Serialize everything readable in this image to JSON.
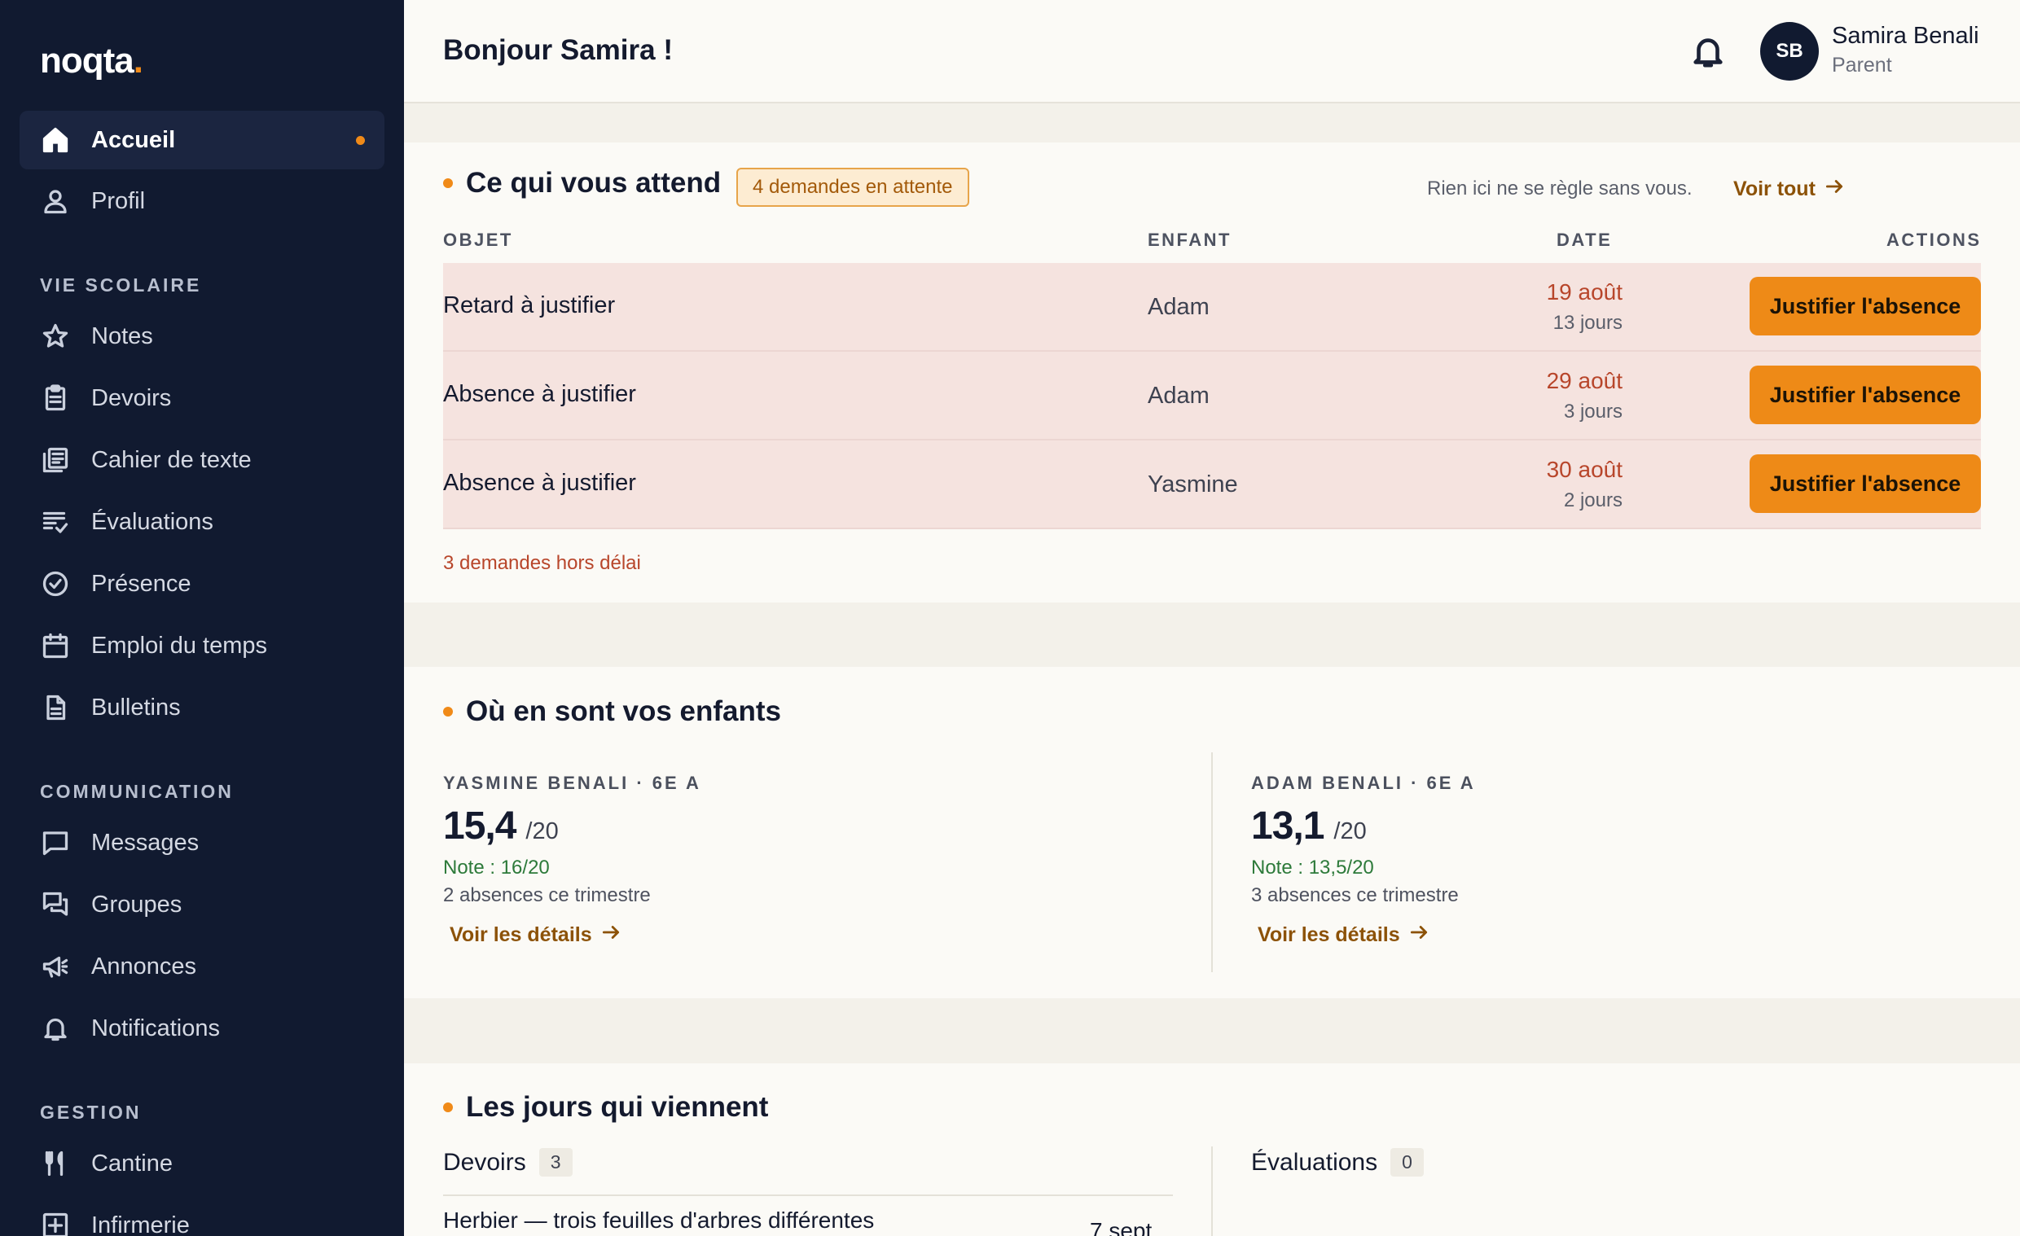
{
  "app": {
    "logo_text": "noqta",
    "logo_dot": ".",
    "accent_color": "#f08a18",
    "sidebar_bg": "#111a30"
  },
  "sidebar": {
    "top_items": [
      {
        "label": "Accueil",
        "icon": "home-icon",
        "active": true
      },
      {
        "label": "Profil",
        "icon": "user-icon",
        "active": false
      }
    ],
    "sections": [
      {
        "title": "VIE SCOLAIRE",
        "items": [
          {
            "label": "Notes",
            "icon": "star-icon"
          },
          {
            "label": "Devoirs",
            "icon": "clipboard-icon"
          },
          {
            "label": "Cahier de texte",
            "icon": "notebook-icon"
          },
          {
            "label": "Évaluations",
            "icon": "checklist-icon"
          },
          {
            "label": "Présence",
            "icon": "check-circle-icon"
          },
          {
            "label": "Emploi du temps",
            "icon": "calendar-icon"
          },
          {
            "label": "Bulletins",
            "icon": "document-icon"
          }
        ]
      },
      {
        "title": "COMMUNICATION",
        "items": [
          {
            "label": "Messages",
            "icon": "message-icon"
          },
          {
            "label": "Groupes",
            "icon": "chat-group-icon"
          },
          {
            "label": "Annonces",
            "icon": "megaphone-icon"
          },
          {
            "label": "Notifications",
            "icon": "bell-icon"
          }
        ]
      },
      {
        "title": "GESTION",
        "items": [
          {
            "label": "Cantine",
            "icon": "fork-knife-icon"
          },
          {
            "label": "Infirmerie",
            "icon": "medical-cross-icon"
          }
        ]
      }
    ]
  },
  "header": {
    "greeting": "Bonjour Samira !",
    "user": {
      "initials": "SB",
      "name": "Samira Benali",
      "role": "Parent"
    }
  },
  "pending": {
    "title": "Ce qui vous attend",
    "badge": "4 demandes en attente",
    "helper": "Rien ici ne se règle sans vous.",
    "see_all": "Voir tout",
    "columns": [
      "OBJET",
      "ENFANT",
      "DATE",
      "ACTIONS"
    ],
    "rows": [
      {
        "objet": "Retard à justifier",
        "enfant": "Adam",
        "date": "19 août",
        "delay": "13 jours",
        "action": "Justifier l'absence"
      },
      {
        "objet": "Absence à justifier",
        "enfant": "Adam",
        "date": "29 août",
        "delay": "3 jours",
        "action": "Justifier l'absence"
      },
      {
        "objet": "Absence à justifier",
        "enfant": "Yasmine",
        "date": "30 août",
        "delay": "2 jours",
        "action": "Justifier l'absence"
      }
    ],
    "late_note": "3 demandes hors délai"
  },
  "children": {
    "title": "Où en sont vos enfants",
    "items": [
      {
        "head": "YASMINE BENALI · 6E A",
        "avg": "15,4",
        "scale": "/20",
        "note": "Note : 16/20",
        "absences": "2 absences ce trimestre",
        "link": "Voir les détails"
      },
      {
        "head": "ADAM BENALI · 6E A",
        "avg": "13,1",
        "scale": "/20",
        "note": "Note : 13,5/20",
        "absences": "3 absences ce trimestre",
        "link": "Voir les détails"
      }
    ]
  },
  "upcoming": {
    "title": "Les jours qui viennent",
    "devoirs": {
      "label": "Devoirs",
      "count": "3"
    },
    "evaluations": {
      "label": "Évaluations",
      "count": "0"
    },
    "first_task": {
      "title": "Herbier — trois feuilles d'arbres différentes",
      "date": "7 sept."
    }
  }
}
